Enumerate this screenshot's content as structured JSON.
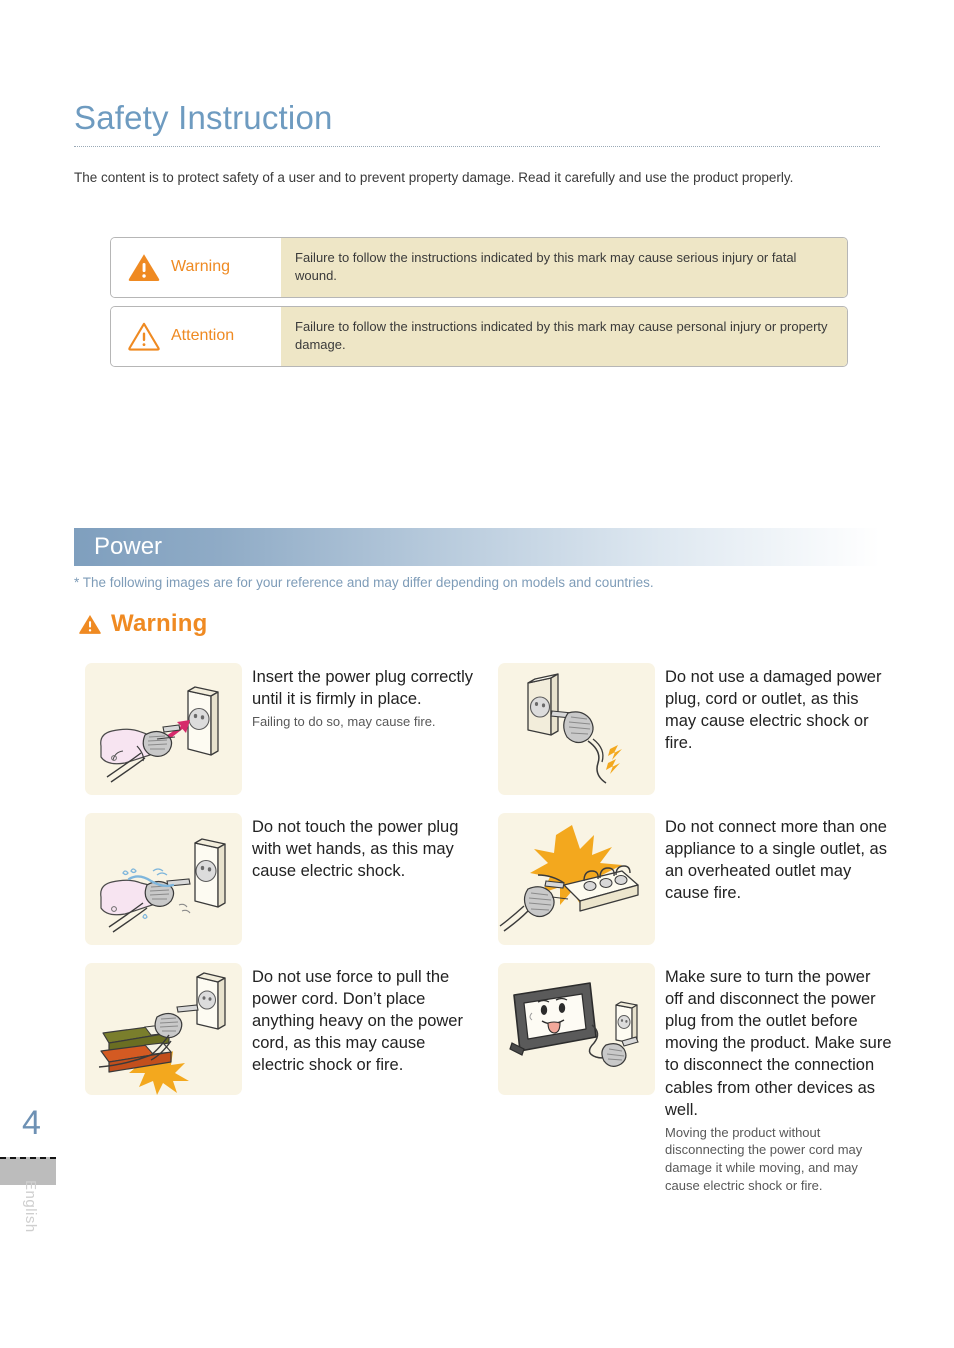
{
  "document": {
    "title": "Safety Instruction",
    "intro": "The content is to protect safety of a user and to prevent property damage. Read it carefully and use the product properly."
  },
  "legend": {
    "rows": [
      {
        "icon": "warning-triangle-filled-icon",
        "label": "Warning",
        "description": "Failure to follow the instructions indicated by this mark may cause serious injury or fatal wound."
      },
      {
        "icon": "attention-triangle-outline-icon",
        "label": "Attention",
        "description": "Failure to follow the instructions indicated by this mark may cause personal injury or property damage."
      }
    ]
  },
  "section": {
    "heading": "Power",
    "note": "* The following images are for your reference and may differ depending on models and countries.",
    "warning_heading": "Warning"
  },
  "items": {
    "left": [
      {
        "icon": "plug-into-outlet-icon",
        "main": "Insert the power plug correctly until it is firmly in place.",
        "sub": "Failing to do so, may cause fire."
      },
      {
        "icon": "wet-hands-plug-icon",
        "main": "Do not touch the power plug with wet hands, as this may cause electric shock.",
        "sub": ""
      },
      {
        "icon": "books-on-cord-icon",
        "main": "Do not use force to pull the power cord. Don’t place anything heavy on the power cord, as this may cause electric shock or fire.",
        "sub": ""
      }
    ],
    "right": [
      {
        "icon": "damaged-cord-icon",
        "main": "Do not use a damaged power plug, cord or outlet, as this may cause electric shock or fire.",
        "sub": ""
      },
      {
        "icon": "overloaded-power-strip-icon",
        "main": "Do not connect more than one appliance to a single outlet, as an overheated outlet may cause fire.",
        "sub": ""
      },
      {
        "icon": "unplug-before-moving-icon",
        "main": "Make sure to turn the power off and disconnect the power plug from the outlet before moving the product. Make sure to disconnect the connection cables from other devices as well.",
        "sub": "Moving the product without disconnecting the power cord may damage it while moving, and may cause electric shock or fire."
      }
    ]
  },
  "footer": {
    "page_number": "4",
    "language": "English"
  },
  "colors": {
    "accent_orange": "#ef8a22",
    "title_blue": "#6e9bc0",
    "legend_desc_bg": "#eee6c6",
    "thumb_bg": "#f9f4e4",
    "note_blue": "#7e9cb8"
  }
}
